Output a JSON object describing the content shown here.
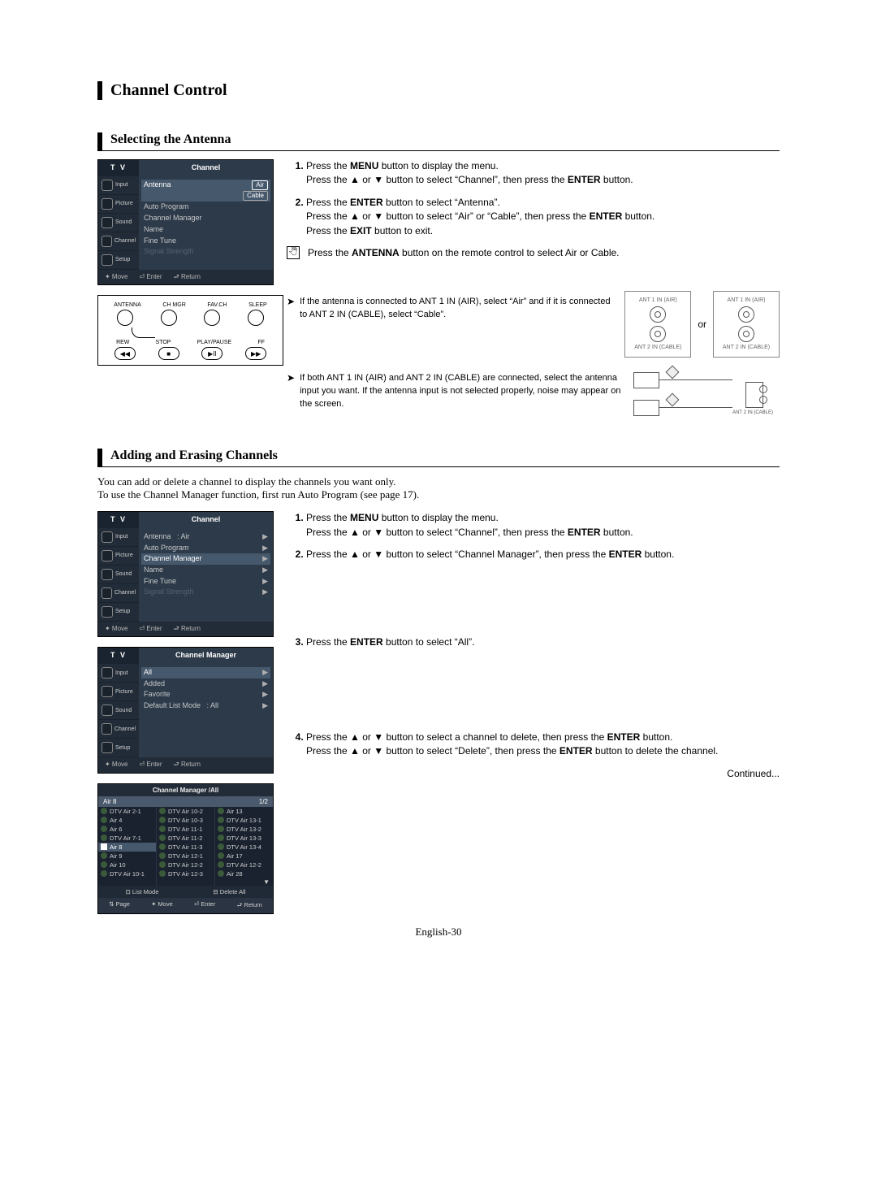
{
  "chapter": "Channel Control",
  "section1": {
    "title": "Selecting the Antenna",
    "osd": {
      "tv": "T V",
      "title": "Channel",
      "side": [
        "Input",
        "Picture",
        "Sound",
        "Channel",
        "Setup"
      ],
      "rows": [
        {
          "label": "Antenna",
          "value": ": Air",
          "pill": "Cable"
        },
        {
          "label": "Auto Program"
        },
        {
          "label": "Channel Manager"
        },
        {
          "label": "Name"
        },
        {
          "label": "Fine Tune"
        },
        {
          "label": "Signal Strength",
          "dim": true
        }
      ],
      "footer": [
        "✦ Move",
        "⏎ Enter",
        "⮐ Return"
      ]
    },
    "remote": {
      "top": [
        "ANTENNA",
        "CH MGR",
        "FAV.CH",
        "SLEEP"
      ],
      "bot": [
        "REW",
        "STOP",
        "PLAY/PAUSE",
        "FF"
      ],
      "symbols": [
        "◀◀",
        "■",
        "▶II",
        "▶▶"
      ]
    },
    "steps": [
      "Press the <b>MENU</b> button to display the menu.<br>Press the ▲ or ▼ button to select “Channel”, then press the <b>ENTER</b> button.",
      "Press the <b>ENTER</b> button to select “Antenna”.<br>Press the ▲ or ▼ button to select “Air” or “Cable”, then press the <b>ENTER</b> button.<br>Press the <b>EXIT</b> button to exit."
    ],
    "note": "Press the <b>ANTENNA</b> button on the remote control to select Air or Cable.",
    "arrow1": "If the antenna is connected to ANT 1 IN (AIR), select “Air” and if it is connected to ANT 2 IN (CABLE), select “Cable”.",
    "or": "or",
    "arrow2": "If both ANT 1 IN (AIR) and ANT 2 IN (CABLE) are connected, select the antenna input you want. If the antenna input is not selected properly, noise may appear on the screen.",
    "port_labels": {
      "ant1": "ANT 1 IN (AIR)",
      "ant2": "ANT 2 IN (CABLE)"
    }
  },
  "section2": {
    "title": "Adding and Erasing Channels",
    "intro": "You can add or delete a channel to display the channels you want only.\nTo use the Channel Manager function, first run Auto Program (see page 17).",
    "osd1": {
      "tv": "T V",
      "title": "Channel",
      "side": [
        "Input",
        "Picture",
        "Sound",
        "Channel",
        "Setup"
      ],
      "rows": [
        {
          "label": "Antenna",
          "value": ": Air",
          "tri": true
        },
        {
          "label": "Auto Program",
          "tri": true
        },
        {
          "label": "Channel Manager",
          "hl": true,
          "tri": true
        },
        {
          "label": "Name",
          "tri": true
        },
        {
          "label": "Fine Tune",
          "tri": true
        },
        {
          "label": "Signal Strength",
          "dim": true,
          "tri": true
        }
      ],
      "footer": [
        "✦ Move",
        "⏎ Enter",
        "⮐ Return"
      ]
    },
    "osd2": {
      "tv": "T V",
      "title": "Channel Manager",
      "side": [
        "Input",
        "Picture",
        "Sound",
        "Channel",
        "Setup"
      ],
      "rows": [
        {
          "label": "All",
          "hl": true,
          "tri": true
        },
        {
          "label": "Added",
          "tri": true
        },
        {
          "label": "Favorite",
          "tri": true
        },
        {
          "label": "Default List Mode",
          "value": ": All",
          "tri": true
        }
      ],
      "footer": [
        "✦ Move",
        "⏎ Enter",
        "⮐ Return"
      ]
    },
    "grid": {
      "title": "Channel Manager /All",
      "current": "Air 8",
      "page": "1/2",
      "col1": [
        "DTV Air 2-1",
        "Air 4",
        "Air 6",
        "DTV Air 7-1",
        "Air 8",
        "Air 9",
        "Air 10",
        "DTV Air 10-1"
      ],
      "col2": [
        "DTV Air 10-2",
        "DTV Air 10-3",
        "DTV Air 11-1",
        "DTV Air 11-2",
        "DTV Air 11-3",
        "DTV Air 12-1",
        "DTV Air 12-2",
        "DTV Air 12-3"
      ],
      "col3": [
        "Air 13",
        "DTV Air 13-1",
        "DTV Air 13-2",
        "DTV Air 13-3",
        "DTV Air 13-4",
        "Air 17",
        "DTV Air 12-2",
        "Air 28"
      ],
      "selected": "Air 8",
      "bar": [
        "⊡ List Mode",
        "⊟ Delete All"
      ],
      "bar2": [
        "⇅ Page",
        "✦ Move",
        "⏎ Enter",
        "⮐ Return"
      ]
    },
    "steps": [
      "Press the <b>MENU</b> button to display the menu.<br>Press the ▲ or ▼ button to select “Channel”, then press the <b>ENTER</b> button.",
      "Press the ▲ or ▼ button to select “Channel Manager”, then press the <b>ENTER</b> button.",
      "Press the <b>ENTER</b> button to select “All”.",
      "Press the ▲ or ▼ button to select a channel to delete, then press the <b>ENTER</b> button.<br>Press the ▲ or ▼ button to select “Delete”, then press the <b>ENTER</b> button to delete the channel."
    ]
  },
  "continued": "Continued...",
  "pagenum": "English-30"
}
